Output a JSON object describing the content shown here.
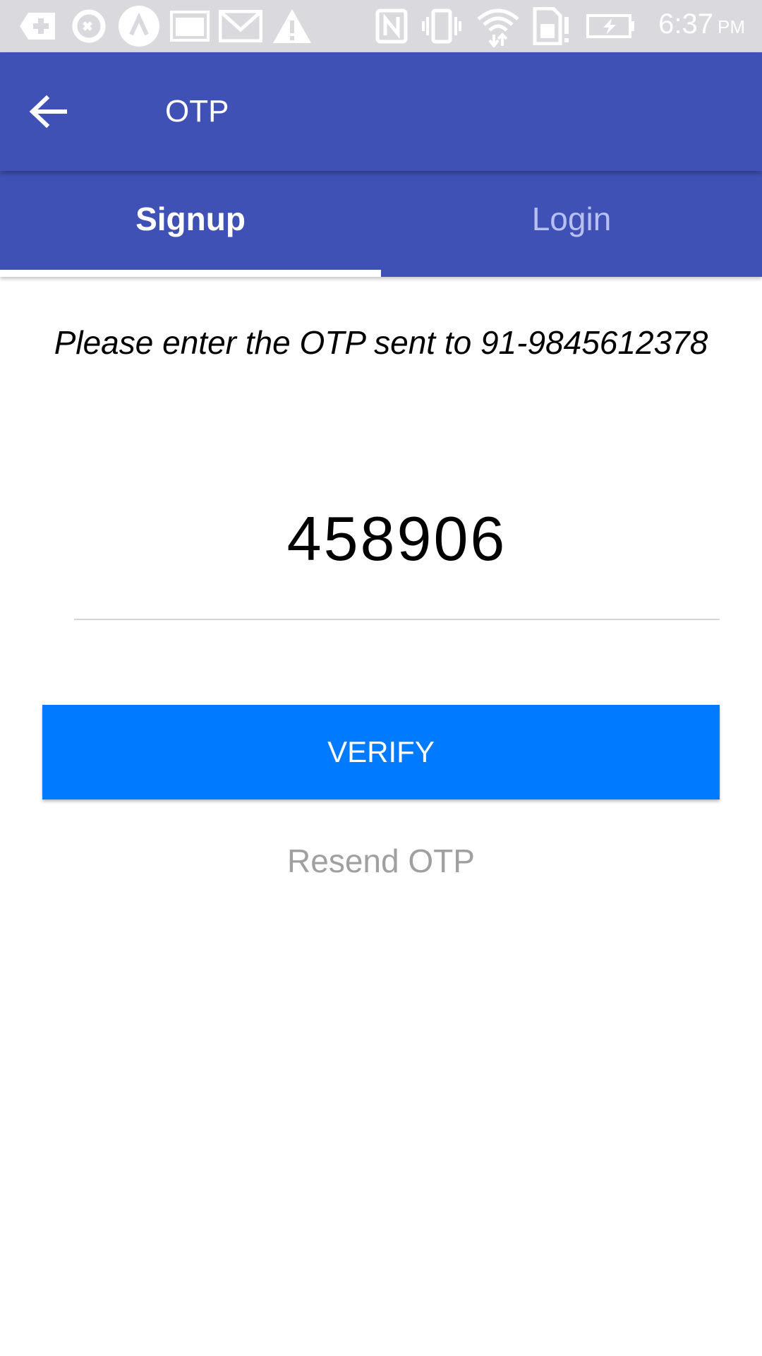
{
  "status_bar": {
    "left_icons": [
      "add-box-icon",
      "sync-icon",
      "caret-up-icon",
      "image-icon",
      "gmail-icon",
      "warning-icon"
    ],
    "right_icons": [
      "nfc-icon",
      "vibrate-icon",
      "wifi-icon",
      "sim-alert-icon",
      "battery-charging-icon"
    ],
    "time": "6:37",
    "ampm": "PM"
  },
  "appbar": {
    "title": "OTP",
    "color": "#3f51b5"
  },
  "tabs": [
    {
      "label": "Signup",
      "active": true
    },
    {
      "label": "Login",
      "active": false
    }
  ],
  "content": {
    "instruction": "Please enter the OTP sent to 91-9845612378",
    "otp_value": "458906",
    "verify_label": "VERIFY",
    "verify_color": "#007aff",
    "resend_label": "Resend OTP"
  }
}
